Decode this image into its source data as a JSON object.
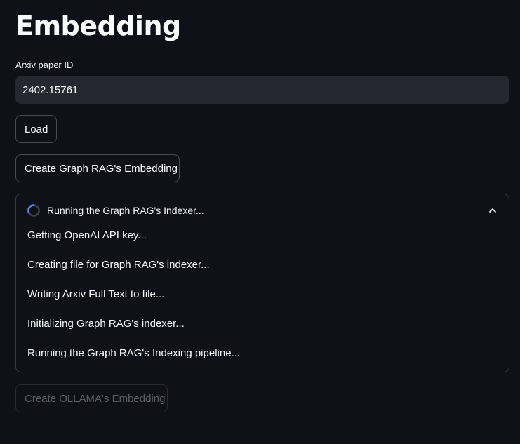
{
  "page": {
    "title": "Embedding"
  },
  "paper_id": {
    "label": "Arxiv paper ID",
    "value": "2402.15761"
  },
  "buttons": {
    "load": "Load",
    "create_graph_rag": "Create Graph RAG's Embedding",
    "create_ollama": "Create OLLAMA's Embedding"
  },
  "status": {
    "label": "Running the Graph RAG's Indexer...",
    "expanded": true,
    "steps": [
      "Getting OpenAI API key...",
      "Creating file for Graph RAG's indexer...",
      "Writing Arxiv Full Text to file...",
      "Initializing Graph RAG's indexer...",
      "Running the Graph RAG's Indexing pipeline..."
    ]
  },
  "colors": {
    "background": "#0e1117",
    "input_background": "#262730",
    "spinner_arc": "#5b8def",
    "disabled_text": "#5c5e66"
  },
  "icons": {
    "spinner": "spinner-icon",
    "collapse": "chevron-up-icon"
  }
}
